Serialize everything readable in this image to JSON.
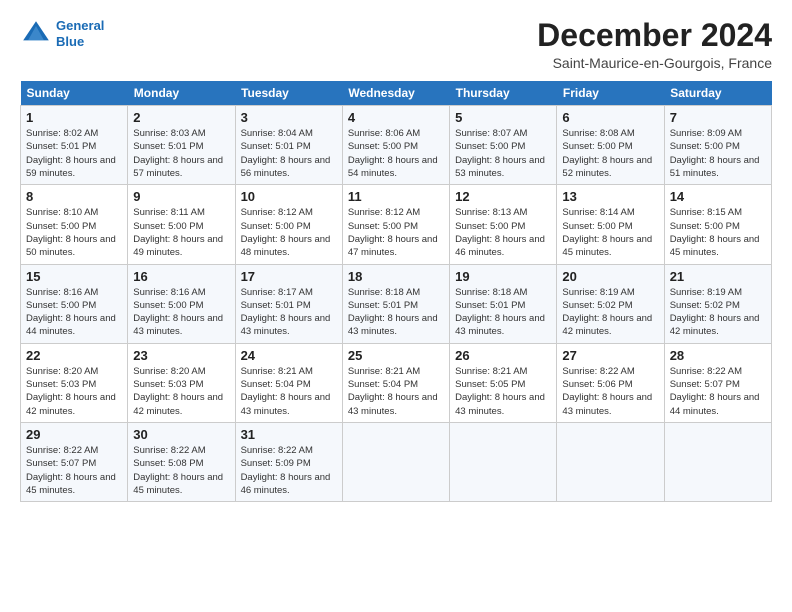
{
  "logo": {
    "line1": "General",
    "line2": "Blue"
  },
  "title": "December 2024",
  "location": "Saint-Maurice-en-Gourgois, France",
  "days_of_week": [
    "Sunday",
    "Monday",
    "Tuesday",
    "Wednesday",
    "Thursday",
    "Friday",
    "Saturday"
  ],
  "weeks": [
    [
      {
        "day": 1,
        "sunrise": "8:02 AM",
        "sunset": "5:01 PM",
        "daylight": "8 hours and 59 minutes."
      },
      {
        "day": 2,
        "sunrise": "8:03 AM",
        "sunset": "5:01 PM",
        "daylight": "8 hours and 57 minutes."
      },
      {
        "day": 3,
        "sunrise": "8:04 AM",
        "sunset": "5:01 PM",
        "daylight": "8 hours and 56 minutes."
      },
      {
        "day": 4,
        "sunrise": "8:06 AM",
        "sunset": "5:00 PM",
        "daylight": "8 hours and 54 minutes."
      },
      {
        "day": 5,
        "sunrise": "8:07 AM",
        "sunset": "5:00 PM",
        "daylight": "8 hours and 53 minutes."
      },
      {
        "day": 6,
        "sunrise": "8:08 AM",
        "sunset": "5:00 PM",
        "daylight": "8 hours and 52 minutes."
      },
      {
        "day": 7,
        "sunrise": "8:09 AM",
        "sunset": "5:00 PM",
        "daylight": "8 hours and 51 minutes."
      }
    ],
    [
      {
        "day": 8,
        "sunrise": "8:10 AM",
        "sunset": "5:00 PM",
        "daylight": "8 hours and 50 minutes."
      },
      {
        "day": 9,
        "sunrise": "8:11 AM",
        "sunset": "5:00 PM",
        "daylight": "8 hours and 49 minutes."
      },
      {
        "day": 10,
        "sunrise": "8:12 AM",
        "sunset": "5:00 PM",
        "daylight": "8 hours and 48 minutes."
      },
      {
        "day": 11,
        "sunrise": "8:12 AM",
        "sunset": "5:00 PM",
        "daylight": "8 hours and 47 minutes."
      },
      {
        "day": 12,
        "sunrise": "8:13 AM",
        "sunset": "5:00 PM",
        "daylight": "8 hours and 46 minutes."
      },
      {
        "day": 13,
        "sunrise": "8:14 AM",
        "sunset": "5:00 PM",
        "daylight": "8 hours and 45 minutes."
      },
      {
        "day": 14,
        "sunrise": "8:15 AM",
        "sunset": "5:00 PM",
        "daylight": "8 hours and 45 minutes."
      }
    ],
    [
      {
        "day": 15,
        "sunrise": "8:16 AM",
        "sunset": "5:00 PM",
        "daylight": "8 hours and 44 minutes."
      },
      {
        "day": 16,
        "sunrise": "8:16 AM",
        "sunset": "5:00 PM",
        "daylight": "8 hours and 43 minutes."
      },
      {
        "day": 17,
        "sunrise": "8:17 AM",
        "sunset": "5:01 PM",
        "daylight": "8 hours and 43 minutes."
      },
      {
        "day": 18,
        "sunrise": "8:18 AM",
        "sunset": "5:01 PM",
        "daylight": "8 hours and 43 minutes."
      },
      {
        "day": 19,
        "sunrise": "8:18 AM",
        "sunset": "5:01 PM",
        "daylight": "8 hours and 43 minutes."
      },
      {
        "day": 20,
        "sunrise": "8:19 AM",
        "sunset": "5:02 PM",
        "daylight": "8 hours and 42 minutes."
      },
      {
        "day": 21,
        "sunrise": "8:19 AM",
        "sunset": "5:02 PM",
        "daylight": "8 hours and 42 minutes."
      }
    ],
    [
      {
        "day": 22,
        "sunrise": "8:20 AM",
        "sunset": "5:03 PM",
        "daylight": "8 hours and 42 minutes."
      },
      {
        "day": 23,
        "sunrise": "8:20 AM",
        "sunset": "5:03 PM",
        "daylight": "8 hours and 42 minutes."
      },
      {
        "day": 24,
        "sunrise": "8:21 AM",
        "sunset": "5:04 PM",
        "daylight": "8 hours and 43 minutes."
      },
      {
        "day": 25,
        "sunrise": "8:21 AM",
        "sunset": "5:04 PM",
        "daylight": "8 hours and 43 minutes."
      },
      {
        "day": 26,
        "sunrise": "8:21 AM",
        "sunset": "5:05 PM",
        "daylight": "8 hours and 43 minutes."
      },
      {
        "day": 27,
        "sunrise": "8:22 AM",
        "sunset": "5:06 PM",
        "daylight": "8 hours and 43 minutes."
      },
      {
        "day": 28,
        "sunrise": "8:22 AM",
        "sunset": "5:07 PM",
        "daylight": "8 hours and 44 minutes."
      }
    ],
    [
      {
        "day": 29,
        "sunrise": "8:22 AM",
        "sunset": "5:07 PM",
        "daylight": "8 hours and 45 minutes."
      },
      {
        "day": 30,
        "sunrise": "8:22 AM",
        "sunset": "5:08 PM",
        "daylight": "8 hours and 45 minutes."
      },
      {
        "day": 31,
        "sunrise": "8:22 AM",
        "sunset": "5:09 PM",
        "daylight": "8 hours and 46 minutes."
      },
      null,
      null,
      null,
      null
    ]
  ],
  "colors": {
    "header_bg": "#2874be",
    "header_text": "#ffffff",
    "odd_row": "#f5f8fc",
    "even_row": "#ffffff"
  }
}
